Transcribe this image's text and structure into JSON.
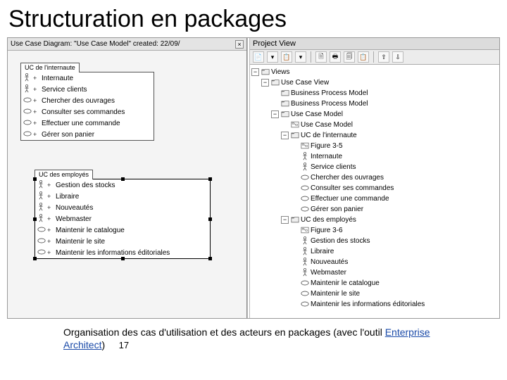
{
  "slide": {
    "title": "Structuration en packages",
    "caption_prefix": "Organisation des cas d'utilisation et des acteurs en packages (avec l'outil ",
    "caption_link": "Enterprise Architect",
    "caption_suffix": ")",
    "page_number": "17"
  },
  "diagram": {
    "tab_label": "Use Case Diagram: \"Use Case Model\"  created: 22/09/",
    "pkg1": {
      "title": "UC de l'internaute",
      "items": [
        {
          "icon": "actor",
          "label": "Internaute"
        },
        {
          "icon": "actor",
          "label": "Service clients"
        },
        {
          "icon": "uc",
          "label": "Chercher des ouvrages"
        },
        {
          "icon": "uc",
          "label": "Consulter ses commandes"
        },
        {
          "icon": "uc",
          "label": "Effectuer une commande"
        },
        {
          "icon": "uc",
          "label": "Gérer son panier"
        }
      ]
    },
    "pkg2": {
      "title": "UC des employés",
      "items": [
        {
          "icon": "actor",
          "label": "Gestion des stocks"
        },
        {
          "icon": "actor",
          "label": "Libraire"
        },
        {
          "icon": "actor",
          "label": "Nouveautés"
        },
        {
          "icon": "actor",
          "label": "Webmaster"
        },
        {
          "icon": "uc",
          "label": "Maintenir le catalogue"
        },
        {
          "icon": "uc",
          "label": "Maintenir le site"
        },
        {
          "icon": "uc",
          "label": "Maintenir les informations éditoriales"
        }
      ]
    }
  },
  "project_view": {
    "title": "Project View",
    "toolbar_icons": [
      "📄",
      "▾",
      "📋",
      "▾",
      "∥",
      "🗎",
      "🖶",
      "🗐",
      "📋",
      "∥",
      "⇧",
      "⇩"
    ],
    "tree": [
      {
        "d": 0,
        "exp": "-",
        "icon": "folder",
        "label": "Views"
      },
      {
        "d": 1,
        "exp": "-",
        "icon": "folder",
        "label": "Use Case View"
      },
      {
        "d": 2,
        "exp": "",
        "icon": "folder",
        "label": "Business Process Model"
      },
      {
        "d": 2,
        "exp": "",
        "icon": "folder",
        "label": "Business Process Model"
      },
      {
        "d": 2,
        "exp": "-",
        "icon": "folder",
        "label": "Use Case Model"
      },
      {
        "d": 3,
        "exp": "",
        "icon": "diag",
        "label": "Use Case Model"
      },
      {
        "d": 3,
        "exp": "-",
        "icon": "folder",
        "label": "UC de l'internaute"
      },
      {
        "d": 4,
        "exp": "",
        "icon": "diag",
        "label": "Figure 3-5"
      },
      {
        "d": 4,
        "exp": "",
        "icon": "actor",
        "label": "Internaute"
      },
      {
        "d": 4,
        "exp": "",
        "icon": "actor",
        "label": "Service clients"
      },
      {
        "d": 4,
        "exp": "",
        "icon": "uc",
        "label": "Chercher des ouvrages"
      },
      {
        "d": 4,
        "exp": "",
        "icon": "uc",
        "label": "Consulter ses commandes"
      },
      {
        "d": 4,
        "exp": "",
        "icon": "uc",
        "label": "Effectuer une commande"
      },
      {
        "d": 4,
        "exp": "",
        "icon": "uc",
        "label": "Gérer son panier"
      },
      {
        "d": 3,
        "exp": "-",
        "icon": "folder",
        "label": "UC des employés"
      },
      {
        "d": 4,
        "exp": "",
        "icon": "diag",
        "label": "Figure 3-6"
      },
      {
        "d": 4,
        "exp": "",
        "icon": "actor",
        "label": "Gestion des stocks"
      },
      {
        "d": 4,
        "exp": "",
        "icon": "actor",
        "label": "Libraire"
      },
      {
        "d": 4,
        "exp": "",
        "icon": "actor",
        "label": "Nouveautés"
      },
      {
        "d": 4,
        "exp": "",
        "icon": "actor",
        "label": "Webmaster"
      },
      {
        "d": 4,
        "exp": "",
        "icon": "uc",
        "label": "Maintenir le catalogue"
      },
      {
        "d": 4,
        "exp": "",
        "icon": "uc",
        "label": "Maintenir le site"
      },
      {
        "d": 4,
        "exp": "",
        "icon": "uc",
        "label": "Maintenir les informations éditoriales"
      }
    ]
  }
}
